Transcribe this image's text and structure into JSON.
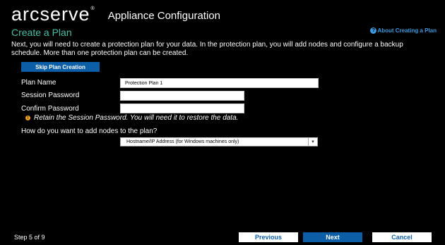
{
  "header": {
    "logo_text": "arcserve",
    "logo_trademark": "®",
    "app_title": "Appliance Configuration"
  },
  "page": {
    "title": "Create a Plan",
    "help_link": "About Creating a Plan",
    "help_icon_glyph": "?",
    "intro": "Next, you will need to create a protection plan for your data. In the protection plan, you will add nodes and configure a backup schedule. More than one protection plan can be created."
  },
  "skip_button": "Skip Plan Creation",
  "form": {
    "plan_name_label": "Plan Name",
    "plan_name_value": "Protection Plan 1",
    "session_password_label": "Session Password",
    "session_password_value": "",
    "confirm_password_label": "Confirm Password",
    "confirm_password_value": "",
    "retain_note": "Retain the Session Password. You will need it to restore the data.",
    "retain_icon_glyph": "!",
    "nodes_question": "How do you want to add nodes to the plan?",
    "nodes_method_selected": "Hostname/IP Address (for Windows machines only)",
    "select_arrow_glyph": "▼"
  },
  "footer": {
    "step_text": "Step 5 of 9",
    "previous_label": "Previous",
    "next_label": "Next",
    "cancel_label": "Cancel"
  },
  "colors": {
    "background": "#000000",
    "title_teal": "#49bfa8",
    "link_blue": "#3d9be0",
    "button_blue": "#0c5fa6",
    "warning_orange": "#f0a21d"
  },
  "icons": {
    "help": "help-circle-icon",
    "warning": "warning-circle-icon",
    "dropdown": "chevron-down-icon"
  }
}
